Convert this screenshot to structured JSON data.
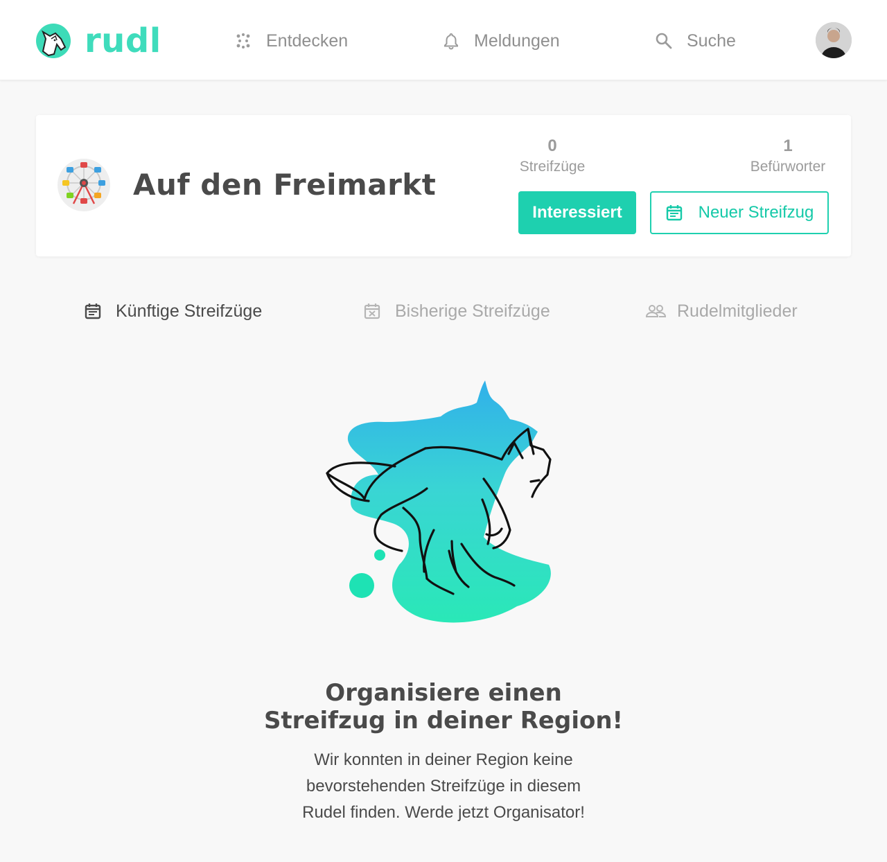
{
  "brand": {
    "name": "rudl",
    "accent": "#3fdcbc",
    "button_color": "#1ed0af"
  },
  "nav": {
    "discover": {
      "label": "Entdecken",
      "icon": "dots-grid-icon"
    },
    "notifications": {
      "label": "Meldungen",
      "icon": "bell-icon"
    },
    "search": {
      "label": "Suche",
      "icon": "search-icon"
    }
  },
  "pack": {
    "title": "Auf den Freimarkt",
    "icon": "ferris-wheel-icon",
    "stats": {
      "raids": {
        "value": "0",
        "label": "Streifzüge"
      },
      "advocates": {
        "value": "1",
        "label": "Befürworter"
      }
    },
    "buttons": {
      "interested": "Interessiert",
      "new_raid": "Neuer Streifzug"
    }
  },
  "tabs": [
    {
      "label": "Künftige Streifzüge",
      "icon": "calendar-icon",
      "active": true
    },
    {
      "label": "Bisherige Streifzüge",
      "icon": "calendar-x-icon",
      "active": false
    },
    {
      "label": "Rudelmitglieder",
      "icon": "people-icon",
      "active": false
    }
  ],
  "empty_state": {
    "title_line1": "Organisiere einen",
    "title_line2": "Streifzug in deiner Region!",
    "body_line1": "Wir konnten in deiner Region keine",
    "body_line2": "bevorstehenden Streifzüge in diesem",
    "body_line3": "Rudel finden. Werde jetzt Organisator!"
  }
}
